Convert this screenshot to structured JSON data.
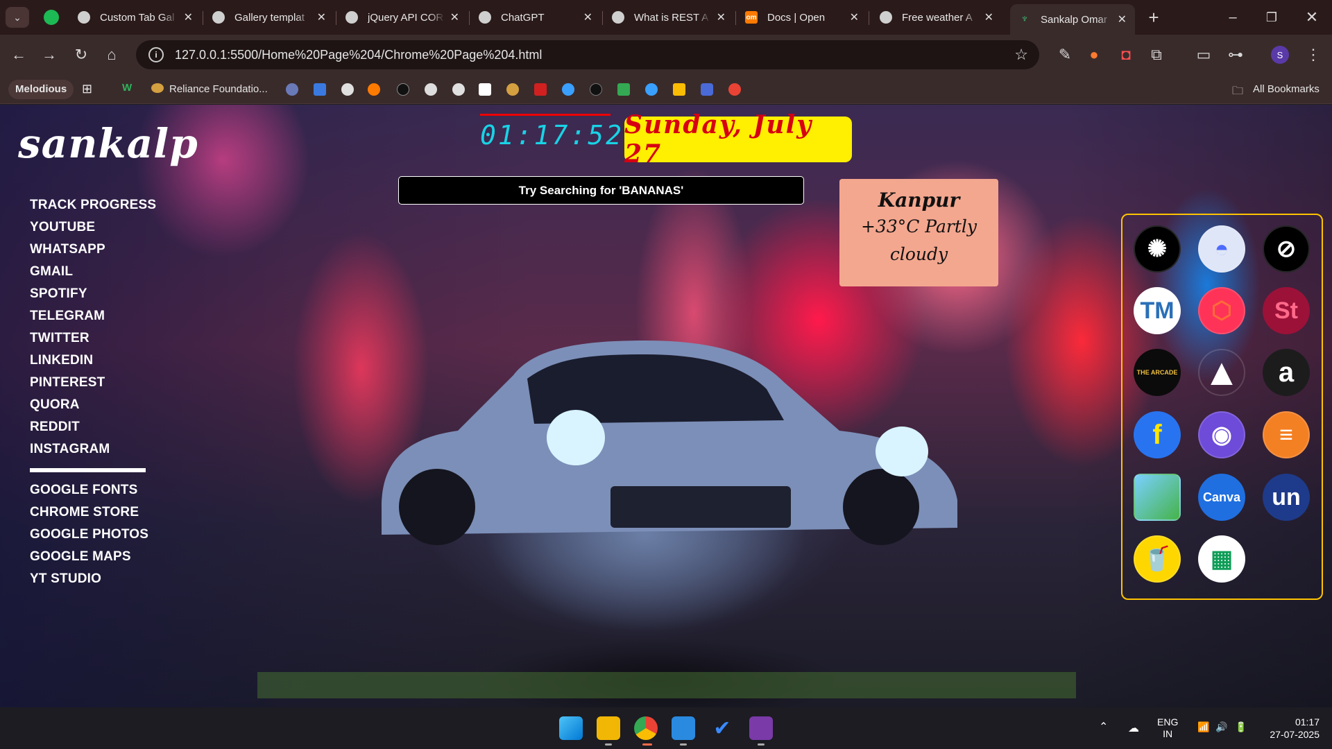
{
  "browser": {
    "tabs": [
      {
        "title": "Custom Tab Gal",
        "icon": "chatgpt-icon"
      },
      {
        "title": "Gallery templat",
        "icon": "chatgpt-icon"
      },
      {
        "title": "jQuery API COR",
        "icon": "chatgpt-icon"
      },
      {
        "title": "ChatGPT",
        "icon": "chatgpt-icon"
      },
      {
        "title": "What is REST A",
        "icon": "chatgpt-icon"
      },
      {
        "title": "Docs | Open",
        "icon": "openmeteo-icon",
        "badge": "om"
      },
      {
        "title": "Free weather A",
        "icon": "chatgpt-icon"
      },
      {
        "title": "Sankalp Omar",
        "icon": "plant-icon",
        "active": true
      }
    ],
    "url": "127.0.0.1:5500/Home%20Page%204/Chrome%20Page%204.html",
    "profile_initial": "S",
    "bookmarks": {
      "folder": "Melodious",
      "item": "Reliance Foundatio...",
      "all_label": "All Bookmarks"
    }
  },
  "page": {
    "logo": "sankalp",
    "nav_primary": [
      "TRACK PROGRESS",
      "YOUTUBE",
      "WHATSAPP",
      "GMAIL",
      "SPOTIFY",
      "TELEGRAM",
      "TWITTER",
      "LINKEDIN",
      "PINTEREST",
      "QUORA",
      "REDDIT",
      "INSTAGRAM"
    ],
    "nav_secondary": [
      "GOOGLE FONTS",
      "CHROME STORE",
      "GOOGLE PHOTOS",
      "GOOGLE MAPS",
      "YT STUDIO"
    ],
    "clock": "01:17:52",
    "date": "Sunday, July 27",
    "search_placeholder": "Try Searching for 'BANANAS'",
    "weather": {
      "city": "Kanpur",
      "condition": "+33°C Partly cloudy"
    },
    "apps": [
      {
        "name": "chatgpt",
        "label": "",
        "bg": "#000000",
        "fg": "#ffffff"
      },
      {
        "name": "deepseek",
        "label": "",
        "bg": "#dfe6f7",
        "fg": "#4d6bfe"
      },
      {
        "name": "perplexity",
        "label": "",
        "bg": "#000000",
        "fg": "#ffffff"
      },
      {
        "name": "typingmaster",
        "label": "TM",
        "bg": "#ffffff",
        "fg": "#2a6fb8"
      },
      {
        "name": "codepen",
        "label": "",
        "bg": "#ff3358",
        "fg": "#ff6a3a"
      },
      {
        "name": "studytonight",
        "label": "St",
        "bg": "#9c1138",
        "fg": "#ff6a8a"
      },
      {
        "name": "the-arcade",
        "label": "THE ARCADE",
        "bg": "#0b0b0b",
        "fg": "#f0c040"
      },
      {
        "name": "google-drive",
        "label": "",
        "bg": "transparent",
        "fg": "#ffffff"
      },
      {
        "name": "amazon",
        "label": "a",
        "bg": "#1c1c1c",
        "fg": "#ffffff"
      },
      {
        "name": "flipkart",
        "label": "f",
        "bg": "#2874f0",
        "fg": "#ffe500"
      },
      {
        "name": "github",
        "label": "",
        "bg": "#6e4bd8",
        "fg": "#ffffff"
      },
      {
        "name": "stack-overflow",
        "label": "",
        "bg": "#f48024",
        "fg": "#ffffff"
      },
      {
        "name": "google-photos",
        "label": "",
        "bg": "transparent",
        "fg": "#ffffff"
      },
      {
        "name": "canva",
        "label": "Canva",
        "bg": "#1f6fe0",
        "fg": "#ffffff"
      },
      {
        "name": "unstop",
        "label": "un",
        "bg": "#1e3a8a",
        "fg": "#ffffff"
      },
      {
        "name": "cup",
        "label": "",
        "bg": "#ffd700",
        "fg": "#000000"
      },
      {
        "name": "google-sheets",
        "label": "",
        "bg": "#ffffff",
        "fg": "#0f9d58"
      }
    ]
  },
  "taskbar": {
    "language": "ENG",
    "region": "IN",
    "time": "01:17",
    "date": "27-07-2025"
  },
  "colors": {
    "clock": "#19d3e6",
    "date_bg": "#ffef00",
    "date_text": "#d60012",
    "weather_bg": "#f4a78f",
    "apps_border": "#ffc400"
  }
}
